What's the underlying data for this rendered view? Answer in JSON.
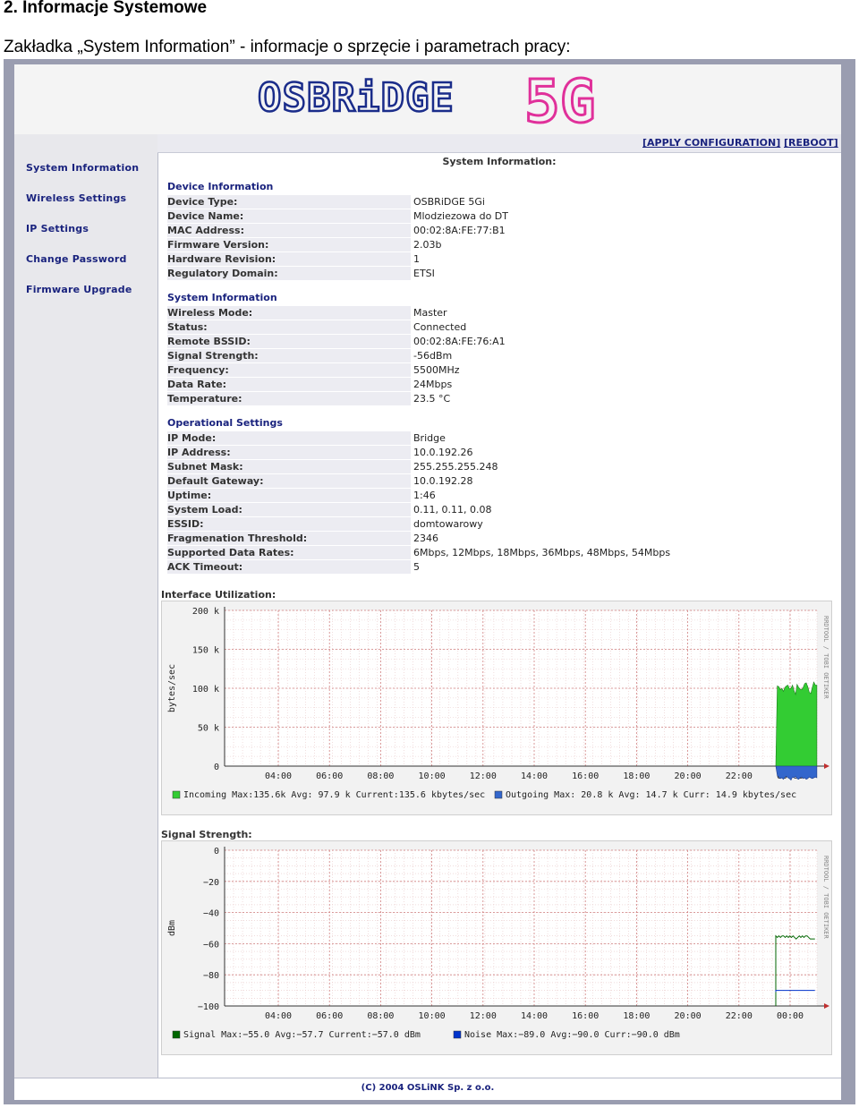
{
  "doc": {
    "heading": "2. Informacje Systemowe",
    "subheading": "Zakładka „System Information” - informacje o sprzęcie i parametrach pracy:"
  },
  "brand": {
    "logo_text": "OSBRiDGE",
    "logo_badge": "5G"
  },
  "nav": {
    "items": [
      {
        "label": "System Information"
      },
      {
        "label": "Wireless Settings"
      },
      {
        "label": "IP Settings"
      },
      {
        "label": "Change Password"
      },
      {
        "label": "Firmware Upgrade"
      }
    ]
  },
  "toolbar": {
    "apply_label": "[APPLY CONFIGURATION]",
    "reboot_label": "[REBOOT]"
  },
  "page_title": "System Information:",
  "sections": [
    {
      "title": "Device Information",
      "rows": [
        {
          "k": "Device Type:",
          "v": "OSBRiDGE 5Gi"
        },
        {
          "k": "Device Name:",
          "v": "Mlodziezowa do DT"
        },
        {
          "k": "MAC Address:",
          "v": "00:02:8A:FE:77:B1"
        },
        {
          "k": "Firmware Version:",
          "v": "2.03b"
        },
        {
          "k": "Hardware Revision:",
          "v": "1"
        },
        {
          "k": "Regulatory Domain:",
          "v": "ETSI"
        }
      ]
    },
    {
      "title": "System Information",
      "rows": [
        {
          "k": "Wireless Mode:",
          "v": "Master"
        },
        {
          "k": "Status:",
          "v": "Connected"
        },
        {
          "k": "Remote BSSID:",
          "v": "00:02:8A:FE:76:A1"
        },
        {
          "k": "Signal Strength:",
          "v": "-56dBm"
        },
        {
          "k": "Frequency:",
          "v": "5500MHz"
        },
        {
          "k": "Data Rate:",
          "v": "24Mbps"
        },
        {
          "k": "Temperature:",
          "v": "23.5 °C"
        }
      ]
    },
    {
      "title": "Operational Settings",
      "rows": [
        {
          "k": "IP Mode:",
          "v": "Bridge"
        },
        {
          "k": "IP Address:",
          "v": "10.0.192.26"
        },
        {
          "k": "Subnet Mask:",
          "v": "255.255.255.248"
        },
        {
          "k": "Default Gateway:",
          "v": "10.0.192.28"
        },
        {
          "k": "Uptime:",
          "v": "1:46"
        },
        {
          "k": "System Load:",
          "v": "0.11, 0.11, 0.08"
        },
        {
          "k": "ESSID:",
          "v": "domtowarowy"
        },
        {
          "k": "Fragmenation Threshold:",
          "v": "2346"
        },
        {
          "k": "Supported Data Rates:",
          "v": "6Mbps, 12Mbps, 18Mbps, 36Mbps, 48Mbps, 54Mbps"
        },
        {
          "k": "ACK Timeout:",
          "v": "5"
        }
      ]
    }
  ],
  "graphs": {
    "interface": {
      "label": "Interface Utilization:",
      "ylabel": "bytes/sec",
      "side_text": "RRDTOOL / TOBI OETIKER",
      "yticks": [
        "200 k",
        "150 k",
        "100 k",
        "50 k",
        "0"
      ],
      "xticks": [
        "04:00",
        "06:00",
        "08:00",
        "10:00",
        "12:00",
        "14:00",
        "16:00",
        "18:00",
        "20:00",
        "22:00",
        "00:00"
      ],
      "legend": "Incoming  Max:135.6k  Avg: 97.9 k  Current:135.6 kbytes/sec",
      "legend2": "Outgoing  Max: 20.8 k  Avg: 14.7 k  Curr: 14.9 kbytes/sec",
      "colors": {
        "incoming": "#33cc33",
        "outgoing": "#3366cc"
      }
    },
    "signal": {
      "label": "Signal Strength:",
      "ylabel": "dBm",
      "side_text": "RRDTOOL / TOBI OETIKER",
      "yticks": [
        "0",
        "−20",
        "−40",
        "−60",
        "−80",
        "−100"
      ],
      "xticks": [
        "04:00",
        "06:00",
        "08:00",
        "10:00",
        "12:00",
        "14:00",
        "16:00",
        "18:00",
        "20:00",
        "22:00",
        "00:00"
      ],
      "legend": "Signal  Max:−55.0  Avg:−57.7  Current:−57.0  dBm",
      "legend2": "Noise  Max:−89.0  Avg:−90.0  Curr:−90.0  dBm",
      "colors": {
        "signal": "#006600",
        "noise": "#0033cc"
      }
    }
  },
  "footer": "(C) 2004 OSLiNK Sp. z o.o."
}
